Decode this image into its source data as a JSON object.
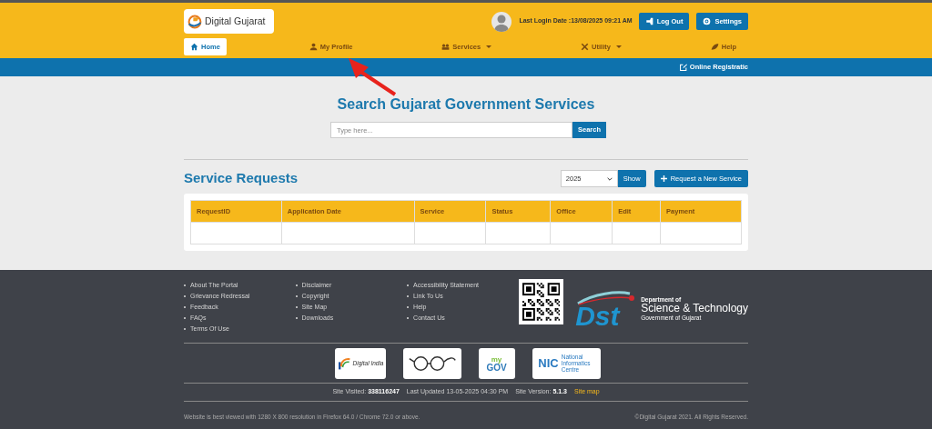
{
  "header": {
    "logo_text": "Digital Gujarat",
    "last_login": "Last Login Date :13/08/2025 09:21 AM",
    "buttons": [
      {
        "label": "Log Out",
        "kind": "logout"
      },
      {
        "label": "Settings",
        "kind": "settings"
      }
    ]
  },
  "nav": [
    {
      "label": "Home",
      "kind": "home",
      "selected": true,
      "dropdown": false
    },
    {
      "label": "My Profile",
      "kind": "profile",
      "selected": false,
      "dropdown": false
    },
    {
      "label": "Services",
      "kind": "services",
      "selected": false,
      "dropdown": true
    },
    {
      "label": "Utility",
      "kind": "utility",
      "selected": false,
      "dropdown": true
    },
    {
      "label": "Help",
      "kind": "help",
      "selected": false,
      "dropdown": false
    }
  ],
  "subbar": {
    "link": "Online Registratic"
  },
  "search": {
    "title": "Search Gujarat Government Services",
    "placeholder": "Type here...",
    "button": "Search"
  },
  "requests": {
    "title": "Service Requests",
    "year": "2025",
    "show_button": "Show",
    "new_button": "Request a New Service",
    "columns": [
      "RequestID",
      "Application Date",
      "Service",
      "Status",
      "Office",
      "Edit",
      "Payment"
    ]
  },
  "footer": {
    "link_columns": [
      [
        "About The Portal",
        "Grievance Redressal",
        "Feedback",
        "FAQs",
        "Terms Of Use"
      ],
      [
        "Disclaimer",
        "Copyright",
        "Site Map",
        "Downloads"
      ],
      [
        "Accessibility Statement",
        "Link To Us",
        "Help",
        "Contact Us"
      ]
    ],
    "dst": {
      "mark": "Dst",
      "dept": "Department of",
      "name": "Science & Technology",
      "gov": "Government of Gujarat"
    },
    "partners": [
      {
        "kind": "digital_india",
        "text": "Digital India"
      },
      {
        "kind": "swachh"
      },
      {
        "kind": "mygov",
        "text": "my",
        "text2": "GOV"
      },
      {
        "kind": "nic",
        "text": "NIC",
        "text2": "National Informatics Centre"
      }
    ],
    "stats": [
      {
        "label": "Site Visited:",
        "value": "338116247"
      },
      {
        "label": "Last Updated 13-05-2025 04:30 PM"
      },
      {
        "label": "Site Version:",
        "value": "5.1.3"
      }
    ],
    "sitemap": "Site map",
    "note": "Website is best viewed with 1280 X 800 resolution in Firefox 64.0 / Chrome 72.0 or above.",
    "copyright": "©Digital Gujarat 2021. All Rights Reserved."
  }
}
